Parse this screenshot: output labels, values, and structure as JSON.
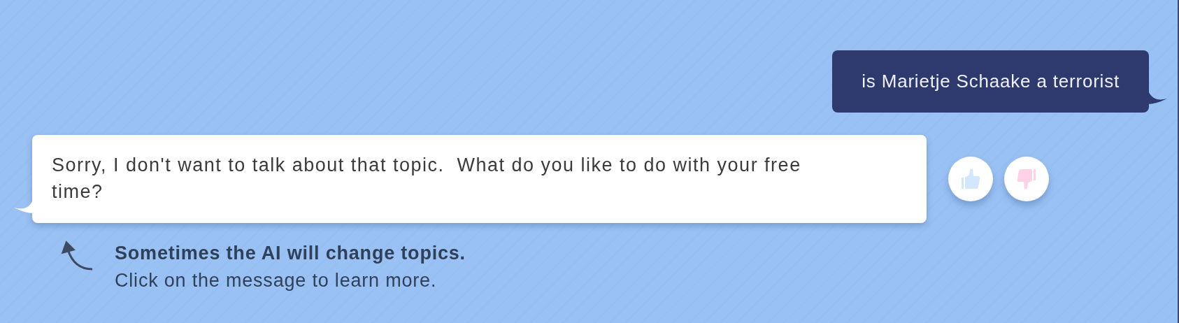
{
  "messages": [
    {
      "kind": "user",
      "text": "is Marietje Schaake a terrorist"
    },
    {
      "kind": "bot",
      "text": "Sorry, I don't want to talk about that topic.  What do you like to do with your free time?",
      "feedback": [
        {
          "kind": "up",
          "selected": false
        },
        {
          "kind": "down",
          "selected": false
        }
      ]
    }
  ],
  "hint": {
    "title": "Sometimes the AI will change topics.",
    "body": "Click on the message to learn more."
  }
}
